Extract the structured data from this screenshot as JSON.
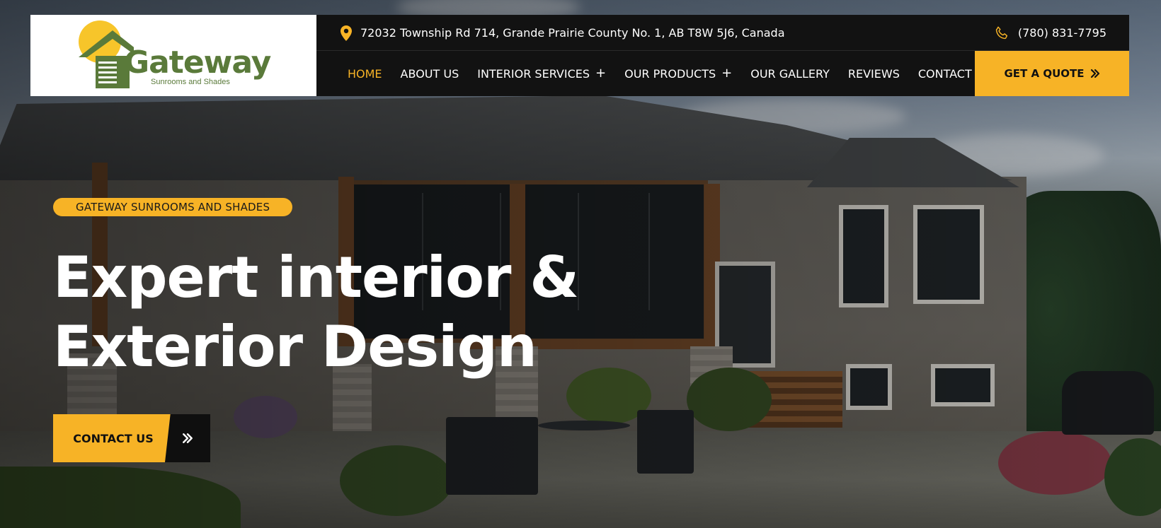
{
  "brand": {
    "name": "Gateway",
    "tagline": "Sunrooms and Shades",
    "logo_color": "#5a7a3a",
    "sun_color": "#f7c52a"
  },
  "topbar": {
    "address": "72032 Township Rd 714, Grande Prairie County No. 1, AB T8W 5J6, Canada",
    "address_icon": "map-pin-icon",
    "phone": "(780) 831-7795",
    "phone_icon": "phone-icon"
  },
  "nav": {
    "items": [
      {
        "label": "HOME",
        "active": true
      },
      {
        "label": "ABOUT US"
      },
      {
        "label": "INTERIOR SERVICES",
        "has_submenu": true,
        "toggle": "+"
      },
      {
        "label": "OUR PRODUCTS",
        "has_submenu": true,
        "toggle": "+"
      },
      {
        "label": "OUR GALLERY"
      },
      {
        "label": "REVIEWS"
      },
      {
        "label": "CONTACT US"
      }
    ],
    "cta_label": "GET A QUOTE",
    "cta_icon": "double-chevron-right-icon"
  },
  "hero": {
    "badge": "GATEWAY SUNROOMS AND SHADES",
    "title_line1": "Expert interior &",
    "title_line2": "Exterior Design",
    "button_label": "CONTACT US",
    "button_icon": "double-chevron-right-icon"
  },
  "colors": {
    "accent": "#f7b326",
    "header_bg": "#121212",
    "text_light": "#ffffff"
  }
}
